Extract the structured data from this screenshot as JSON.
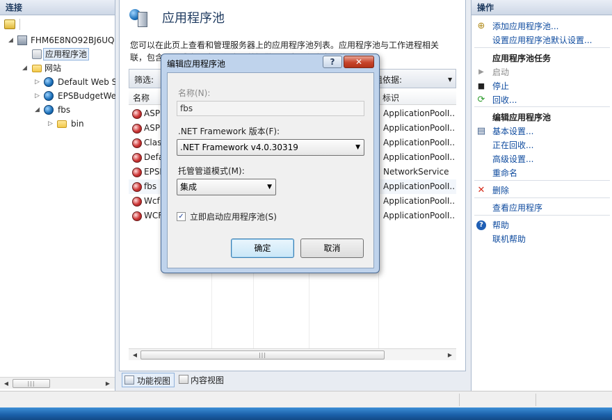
{
  "left": {
    "header": "连接",
    "tree": [
      {
        "label": "FHM6E8NO92BJ6UQ",
        "icon": "server-icon"
      },
      {
        "label": "应用程序池",
        "icon": "app-pool-icon",
        "selected": true
      },
      {
        "label": "网站",
        "icon": "sites-icon"
      },
      {
        "label": "Default Web S",
        "icon": "globe-icon"
      },
      {
        "label": "EPSBudgetWe",
        "icon": "globe-icon"
      },
      {
        "label": "fbs",
        "icon": "globe-icon"
      },
      {
        "label": "bin",
        "icon": "folder-icon"
      }
    ]
  },
  "center": {
    "title": "应用程序池",
    "description": "您可以在此页上查看和管理服务器上的应用程序池列表。应用程序池与工作进程相关联，包含一个或多个应用程序，并提供不同应用程序之间的隔离。",
    "filter_label": "筛选:",
    "group_label": "组依据:",
    "columns": {
      "name": "名称",
      "identity": "标识"
    },
    "rows": [
      {
        "name": "ASP",
        "identity": "ApplicationPoolI..."
      },
      {
        "name": "ASP",
        "identity": "ApplicationPoolI..."
      },
      {
        "name": "Clas",
        "identity": "ApplicationPoolI..."
      },
      {
        "name": "Defa",
        "identity": "ApplicationPoolI..."
      },
      {
        "name": "EPSI",
        "identity": "NetworkService"
      },
      {
        "name": "fbs",
        "identity": "ApplicationPoolI..."
      },
      {
        "name": "Wcf",
        "identity": "ApplicationPoolI..."
      },
      {
        "name": "WCF",
        "identity": "ApplicationPoolI..."
      }
    ],
    "view_tabs": {
      "features": "功能视图",
      "content": "内容视图"
    }
  },
  "right": {
    "header": "操作",
    "items": [
      {
        "label": "添加应用程序池...",
        "icon": "add-pool-icon",
        "type": "link"
      },
      {
        "label": "设置应用程序池默认设置...",
        "icon": "",
        "type": "link"
      },
      {
        "label": "应用程序池任务",
        "type": "heading"
      },
      {
        "label": "启动",
        "icon": "play-icon",
        "type": "disabled"
      },
      {
        "label": "停止",
        "icon": "stop-icon",
        "type": "link"
      },
      {
        "label": "回收...",
        "icon": "recycle-icon",
        "type": "link"
      },
      {
        "label": "编辑应用程序池",
        "type": "heading"
      },
      {
        "label": "基本设置...",
        "icon": "settings-icon",
        "type": "link"
      },
      {
        "label": "正在回收...",
        "icon": "",
        "type": "link"
      },
      {
        "label": "高级设置...",
        "icon": "",
        "type": "link"
      },
      {
        "label": "重命名",
        "icon": "",
        "type": "link"
      },
      {
        "label": "删除",
        "icon": "delete-icon",
        "type": "link"
      },
      {
        "label": "查看应用程序",
        "icon": "",
        "type": "link"
      },
      {
        "label": "帮助",
        "icon": "help-icon",
        "type": "link"
      },
      {
        "label": "联机帮助",
        "icon": "",
        "type": "link"
      }
    ]
  },
  "dialog": {
    "title": "编辑应用程序池",
    "help_button": "?",
    "close_button": "✕",
    "name_label": "名称(N):",
    "name_value": "fbs",
    "framework_label": ".NET Framework 版本(F):",
    "framework_value": ".NET Framework v4.0.30319",
    "pipeline_label": "托管管道模式(M):",
    "pipeline_value": "集成",
    "autostart_label": "立即启动应用程序池(S)",
    "autostart_checked": true,
    "ok_label": "确定",
    "cancel_label": "取消"
  },
  "colors": {
    "link": "#0d4a9e",
    "header_text": "#1e3a5f",
    "delete": "#d62c1a"
  }
}
